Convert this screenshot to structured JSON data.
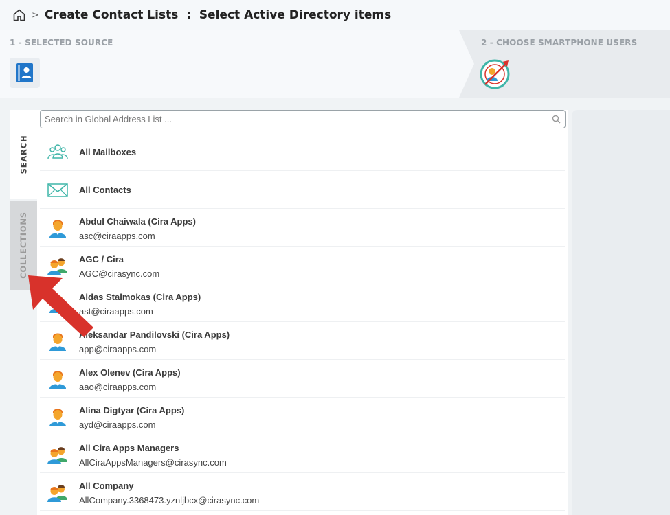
{
  "header": {
    "title": "Create Contact Lists  :  Select Active Directory items",
    "separator": ">"
  },
  "steps": {
    "step1_label": "1 - SELECTED SOURCE",
    "step2_label": "2 - CHOOSE SMARTPHONE USERS"
  },
  "tabs": {
    "search": "SEARCH",
    "collections": "COLLECTIONS"
  },
  "search": {
    "placeholder": "Search in Global Address List ..."
  },
  "colors": {
    "accent_teal": "#3fb5a8",
    "annotation_arrow": "#d8322b",
    "person_skin": "#f4a52c",
    "person_shirt": "#2f9ad8"
  },
  "items": [
    {
      "name": "All Mailboxes",
      "email": "",
      "icon": "group-outline-icon"
    },
    {
      "name": "All Contacts",
      "email": "",
      "icon": "envelope-icon"
    },
    {
      "name": "Abdul Chaiwala (Cira Apps)",
      "email": "asc@ciraapps.com",
      "icon": "person-icon"
    },
    {
      "name": "AGC / Cira",
      "email": "AGC@cirasync.com",
      "icon": "people-icon"
    },
    {
      "name": "Aidas Stalmokas (Cira Apps)",
      "email": "ast@ciraapps.com",
      "icon": "person-icon"
    },
    {
      "name": "Aleksandar Pandilovski (Cira Apps)",
      "email": "app@ciraapps.com",
      "icon": "person-icon"
    },
    {
      "name": "Alex Olenev (Cira Apps)",
      "email": "aao@ciraapps.com",
      "icon": "person-icon"
    },
    {
      "name": "Alina Digtyar (Cira Apps)",
      "email": "ayd@ciraapps.com",
      "icon": "person-icon"
    },
    {
      "name": "All Cira Apps Managers",
      "email": "AllCiraAppsManagers@cirasync.com",
      "icon": "people-icon"
    },
    {
      "name": "All Company",
      "email": "AllCompany.3368473.yznljbcx@cirasync.com",
      "icon": "people-icon"
    }
  ]
}
